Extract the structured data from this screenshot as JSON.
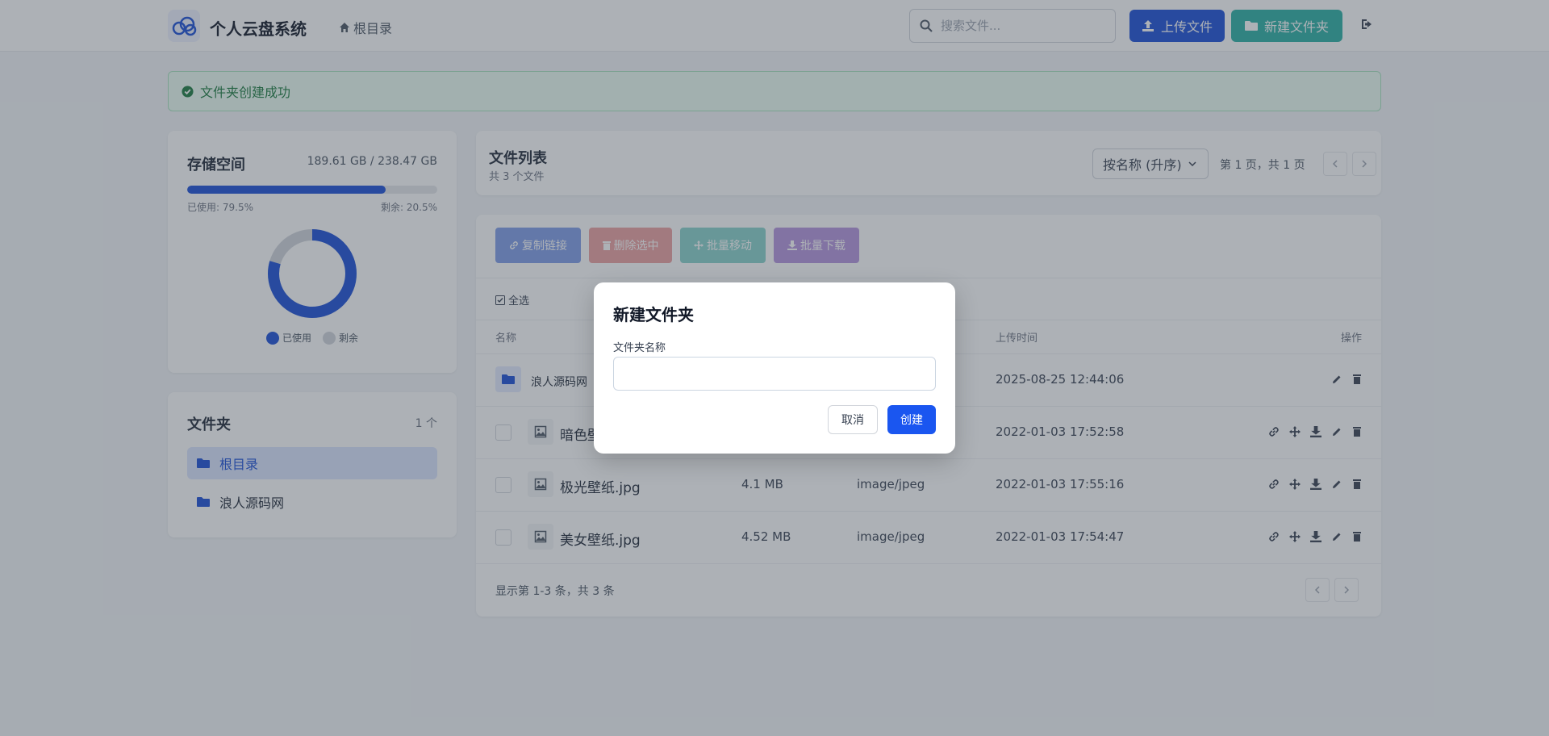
{
  "header": {
    "brand": "个人云盘系统",
    "nav_root": "根目录",
    "search_placeholder": "搜索文件...",
    "upload_label": "上传文件",
    "new_folder_label": "新建文件夹"
  },
  "alert": {
    "message": "文件夹创建成功"
  },
  "storage": {
    "title": "存储空间",
    "size": "189.61 GB / 238.47 GB",
    "used_label": "已使用: 79.5%",
    "free_label": "剩余: 20.5%",
    "used_percent": 79.5,
    "legend_used": "已使用",
    "legend_free": "剩余",
    "used_color": "#1a4fd8",
    "free_color": "#d1d5db"
  },
  "folders": {
    "title": "文件夹",
    "count": "1 个",
    "items": [
      {
        "label": "根目录"
      },
      {
        "label": "浪人源码网"
      }
    ]
  },
  "file_list": {
    "title": "文件列表",
    "subtitle": "共 3 个文件",
    "sort_value": "按名称 (升序)",
    "page_info": "第 1 页，共 1 页",
    "toolbar": {
      "copy_link": "复制链接",
      "delete_selected": "删除选中",
      "batch_move": "批量移动",
      "batch_download": "批量下载"
    },
    "select_all": "全选",
    "columns": {
      "name": "名称",
      "upload_time": "上传时间",
      "actions": "操作"
    },
    "rows": [
      {
        "name": "浪人源码网",
        "size": "",
        "type": "",
        "time": "2025-08-25 12:44:06"
      },
      {
        "name": "暗色壁",
        "size": "",
        "type": "",
        "time": "2022-01-03 17:52:58"
      },
      {
        "name": "极光壁纸.jpg",
        "size": "4.1 MB",
        "type": "image/jpeg",
        "time": "2022-01-03 17:55:16"
      },
      {
        "name": "美女壁纸.jpg",
        "size": "4.52 MB",
        "type": "image/jpeg",
        "time": "2022-01-03 17:54:47"
      }
    ],
    "footer": "显示第 1-3 条，共 3 条"
  },
  "modal": {
    "title": "新建文件夹",
    "label": "文件夹名称",
    "input_value": "",
    "cancel_label": "取消",
    "create_label": "创建"
  }
}
